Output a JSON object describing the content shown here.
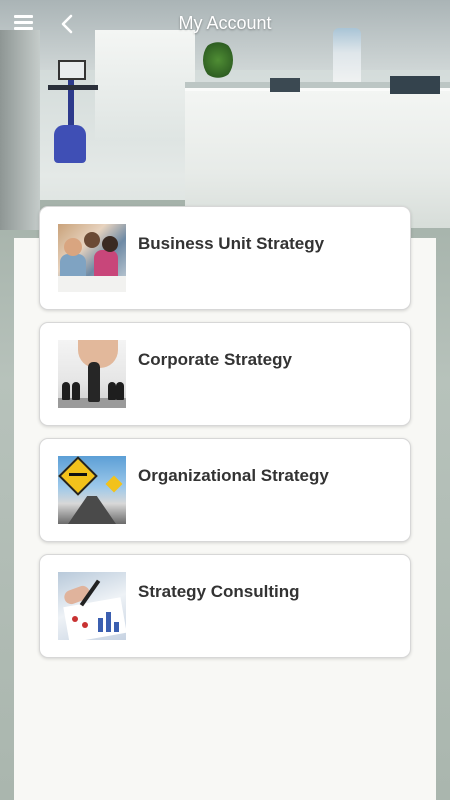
{
  "header": {
    "title": "My Account",
    "menu_icon": "hamburger-menu-icon",
    "back_icon": "chevron-left-icon"
  },
  "colors": {
    "header_text": "#ffffff",
    "card_background": "#ffffff",
    "card_label": "#333333",
    "panel_background": "#f8f8f5"
  },
  "items": [
    {
      "label": "Business Unit Strategy",
      "thumbnail": "business-meeting-photo"
    },
    {
      "label": "Corporate Strategy",
      "thumbnail": "chess-hand-photo"
    },
    {
      "label": "Organizational Strategy",
      "thumbnail": "road-sign-photo"
    },
    {
      "label": "Strategy Consulting",
      "thumbnail": "charts-consulting-photo"
    }
  ]
}
